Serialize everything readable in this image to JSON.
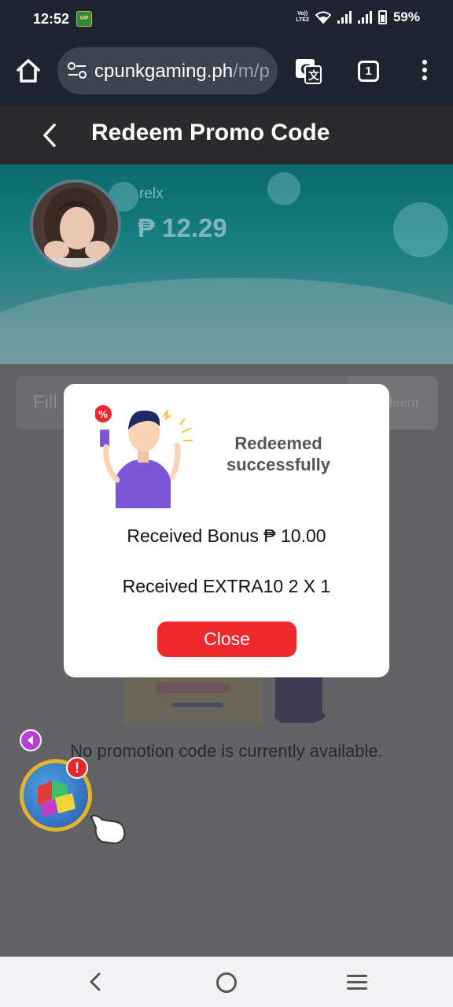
{
  "status_bar": {
    "time": "12:52",
    "network_label": "VoLTE2",
    "battery": "59%"
  },
  "browser": {
    "url_domain": "cpunkgaming.ph",
    "url_path": "/m/p",
    "tab_count": "1",
    "icons": [
      "home-icon",
      "site-settings-icon",
      "translate-icon",
      "tabs-icon",
      "more-menu-icon"
    ]
  },
  "header": {
    "title": "Redeem Promo Code"
  },
  "profile": {
    "username": "relx",
    "balance": "₱ 12.29"
  },
  "promo": {
    "input_placeholder": "Fill",
    "redeem_label": "Redeem"
  },
  "empty_state": {
    "message": "No promotion code is currently available."
  },
  "modal": {
    "status": "Redeemed successfully",
    "line1": "Received Bonus ₱ 10.00",
    "line2": "Received EXTRA10 2 X 1",
    "close_label": "Close"
  },
  "floating": {
    "alert": "!"
  },
  "colors": {
    "accent": "#f0282c",
    "header": "#2b2b2d",
    "banner": "#177f80",
    "overlay": "#636366"
  }
}
